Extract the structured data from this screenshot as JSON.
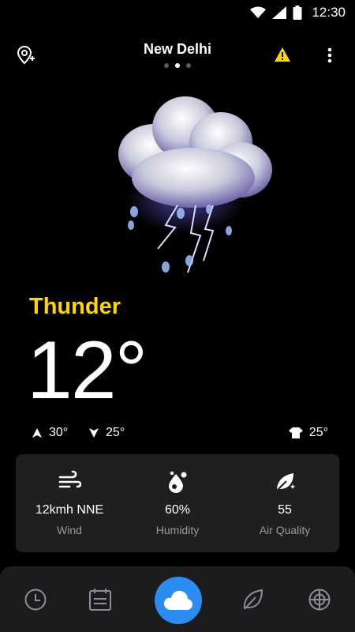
{
  "status_bar": {
    "time": "12:30"
  },
  "header": {
    "city": "New Delhi",
    "page_count": 3,
    "active_page": 1
  },
  "current": {
    "condition": "Thunder",
    "temperature": "12°",
    "high": "30°",
    "low": "25°",
    "feels_like": "25°"
  },
  "details": {
    "wind": {
      "value": "12kmh NNE",
      "label": "Wind",
      "icon": "wind-icon"
    },
    "humidity": {
      "value": "60%",
      "label": "Humidity",
      "icon": "humidity-icon"
    },
    "air_quality": {
      "value": "55",
      "label": "Air Quality",
      "icon": "leaf-icon"
    }
  },
  "colors": {
    "accent_yellow": "#ffd600",
    "active_nav": "#2d8cf0",
    "card_bg": "#1f1f21"
  },
  "nav": {
    "items": [
      "clock-icon",
      "calendar-icon",
      "cloud-icon",
      "leaf-icon",
      "radar-icon"
    ],
    "active": 2
  }
}
